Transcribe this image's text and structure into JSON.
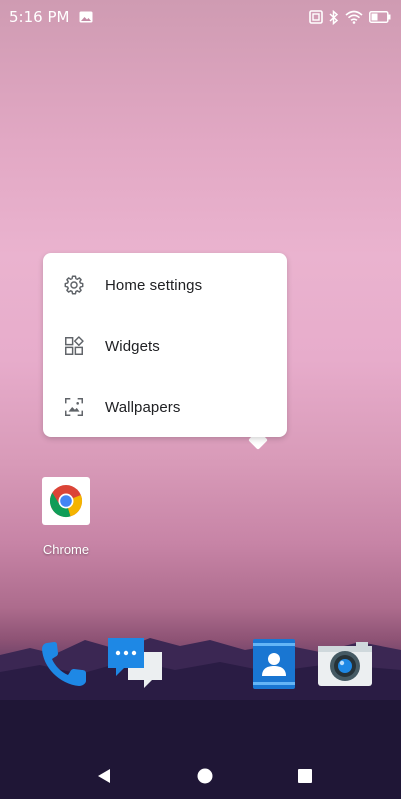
{
  "status_bar": {
    "time": "5:16 PM",
    "icons": [
      "image-notification-icon",
      "nfc-icon",
      "bluetooth-icon",
      "wifi-icon",
      "battery-icon"
    ]
  },
  "popup_menu": {
    "items": [
      {
        "label": "Home settings",
        "icon": "gear-icon"
      },
      {
        "label": "Widgets",
        "icon": "widgets-icon"
      },
      {
        "label": "Wallpapers",
        "icon": "wallpaper-icon"
      }
    ]
  },
  "home_apps": [
    {
      "label": "Chrome",
      "icon": "chrome-icon"
    }
  ],
  "dock": {
    "items": [
      "phone-icon",
      "messages-icon",
      "contacts-icon",
      "camera-icon"
    ]
  },
  "navigation": {
    "buttons": [
      "back-icon",
      "home-icon",
      "recents-icon"
    ]
  },
  "colors": {
    "menu_text": "#202124",
    "menu_icon": "#5f6368",
    "accent_blue": "#1e88e5"
  }
}
